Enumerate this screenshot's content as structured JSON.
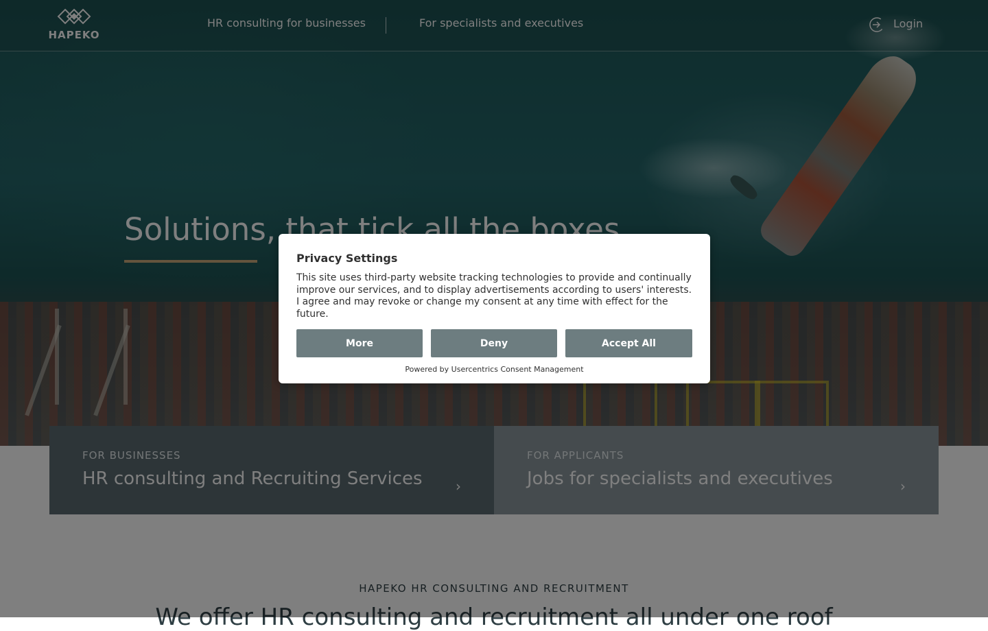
{
  "header": {
    "logo_text": "HAPEKO",
    "nav": [
      {
        "label": "HR consulting for businesses"
      },
      {
        "label": "For specialists and executives"
      }
    ],
    "login_label": "Login"
  },
  "hero": {
    "title": "Solutions, that tick all the boxes"
  },
  "cards": [
    {
      "eyebrow": "FOR BUSINESSES",
      "title": "HR consulting and Recruiting Services"
    },
    {
      "eyebrow": "FOR APPLICANTS",
      "title": "Jobs for specialists and executives"
    }
  ],
  "intro": {
    "eyebrow": "HAPEKO HR CONSULTING AND RECRUITMENT",
    "heading": "We offer HR consulting and recruitment all under one roof"
  },
  "consent": {
    "title": "Privacy Settings",
    "text": "This site uses third-party website tracking technologies to provide and continually improve our services, and to display advertisements according to users' interests. I agree and may revoke or change my consent at any time with effect for the future.",
    "buttons": {
      "more": "More",
      "deny": "Deny",
      "accept": "Accept All"
    },
    "powered_by": "Powered by Usercentrics Consent Management"
  },
  "colors": {
    "accent_underline": "#c8a97a",
    "button": "#6d7d80",
    "card_business": "#5a6a70",
    "card_applicants": "#8a979c"
  },
  "icons": {
    "logo": "hapeko-diamond-logo-icon",
    "login": "login-arrow-icon",
    "chevron": "chevron-right-icon"
  }
}
